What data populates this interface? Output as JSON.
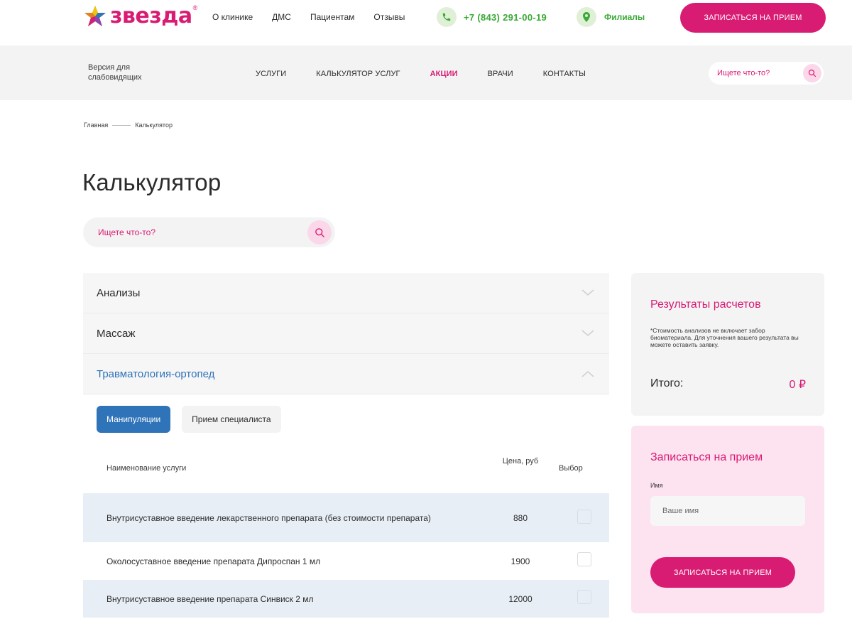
{
  "header": {
    "logo_text": "звезда",
    "logo_reg": "®",
    "nav": [
      "О клинике",
      "ДМС",
      "Пациентам",
      "Отзывы"
    ],
    "phone": "+7 (843) 291-00-19",
    "branches": "Филиалы",
    "cta": "ЗАПИСАТЬСЯ НА ПРИЕМ"
  },
  "navbar": {
    "low_vision": "Версия для слабовидящих",
    "items": [
      "УСЛУГИ",
      "КАЛЬКУЛЯТОР УСЛУГ",
      "АКЦИИ",
      "ВРАЧИ",
      "КОНТАКТЫ"
    ],
    "active_item": "АКЦИИ",
    "search_placeholder": "Ищете что-то?"
  },
  "breadcrumb": [
    "Главная",
    "Калькулятор"
  ],
  "page_title": "Калькулятор",
  "main_search_placeholder": "Ищете что-то?",
  "accordion": [
    {
      "label": "Анализы",
      "open": false
    },
    {
      "label": "Массаж",
      "open": false
    },
    {
      "label": "Травматология-ортопед",
      "open": true
    }
  ],
  "subtabs": [
    {
      "label": "Манипуляции",
      "active": true
    },
    {
      "label": "Прием специалиста",
      "active": false
    }
  ],
  "table": {
    "col_name": "Наименование услуги",
    "col_price": "Цена, руб",
    "col_choice": "Выбор",
    "rows": [
      {
        "name": "Внутрисуставное введение лекарственного препарата (без стоимости препарата)",
        "price": "880",
        "checked": false
      },
      {
        "name": "Околосуставное введение препарата Дипроспан 1 мл",
        "price": "1900",
        "checked": false
      },
      {
        "name": "Внутрисуставное введение препарата Синвиск 2 мл",
        "price": "12000",
        "checked": false
      }
    ]
  },
  "results": {
    "title": "Результаты расчетов",
    "note": "*Стоимость анализов не включает забор биоматериала. Для уточнения вашего результата вы можете оставить заявку.",
    "total_label": "Итого:",
    "total_value": "0 ₽"
  },
  "appointment": {
    "title": "Записаться на прием",
    "name_label": "Имя",
    "name_placeholder": "Ваше имя",
    "submit": "ЗАПИСАТЬСЯ НА ПРИЕМ"
  },
  "colors": {
    "brand": "#d81b73",
    "green": "#3aa935",
    "blue": "#2f73b8"
  }
}
